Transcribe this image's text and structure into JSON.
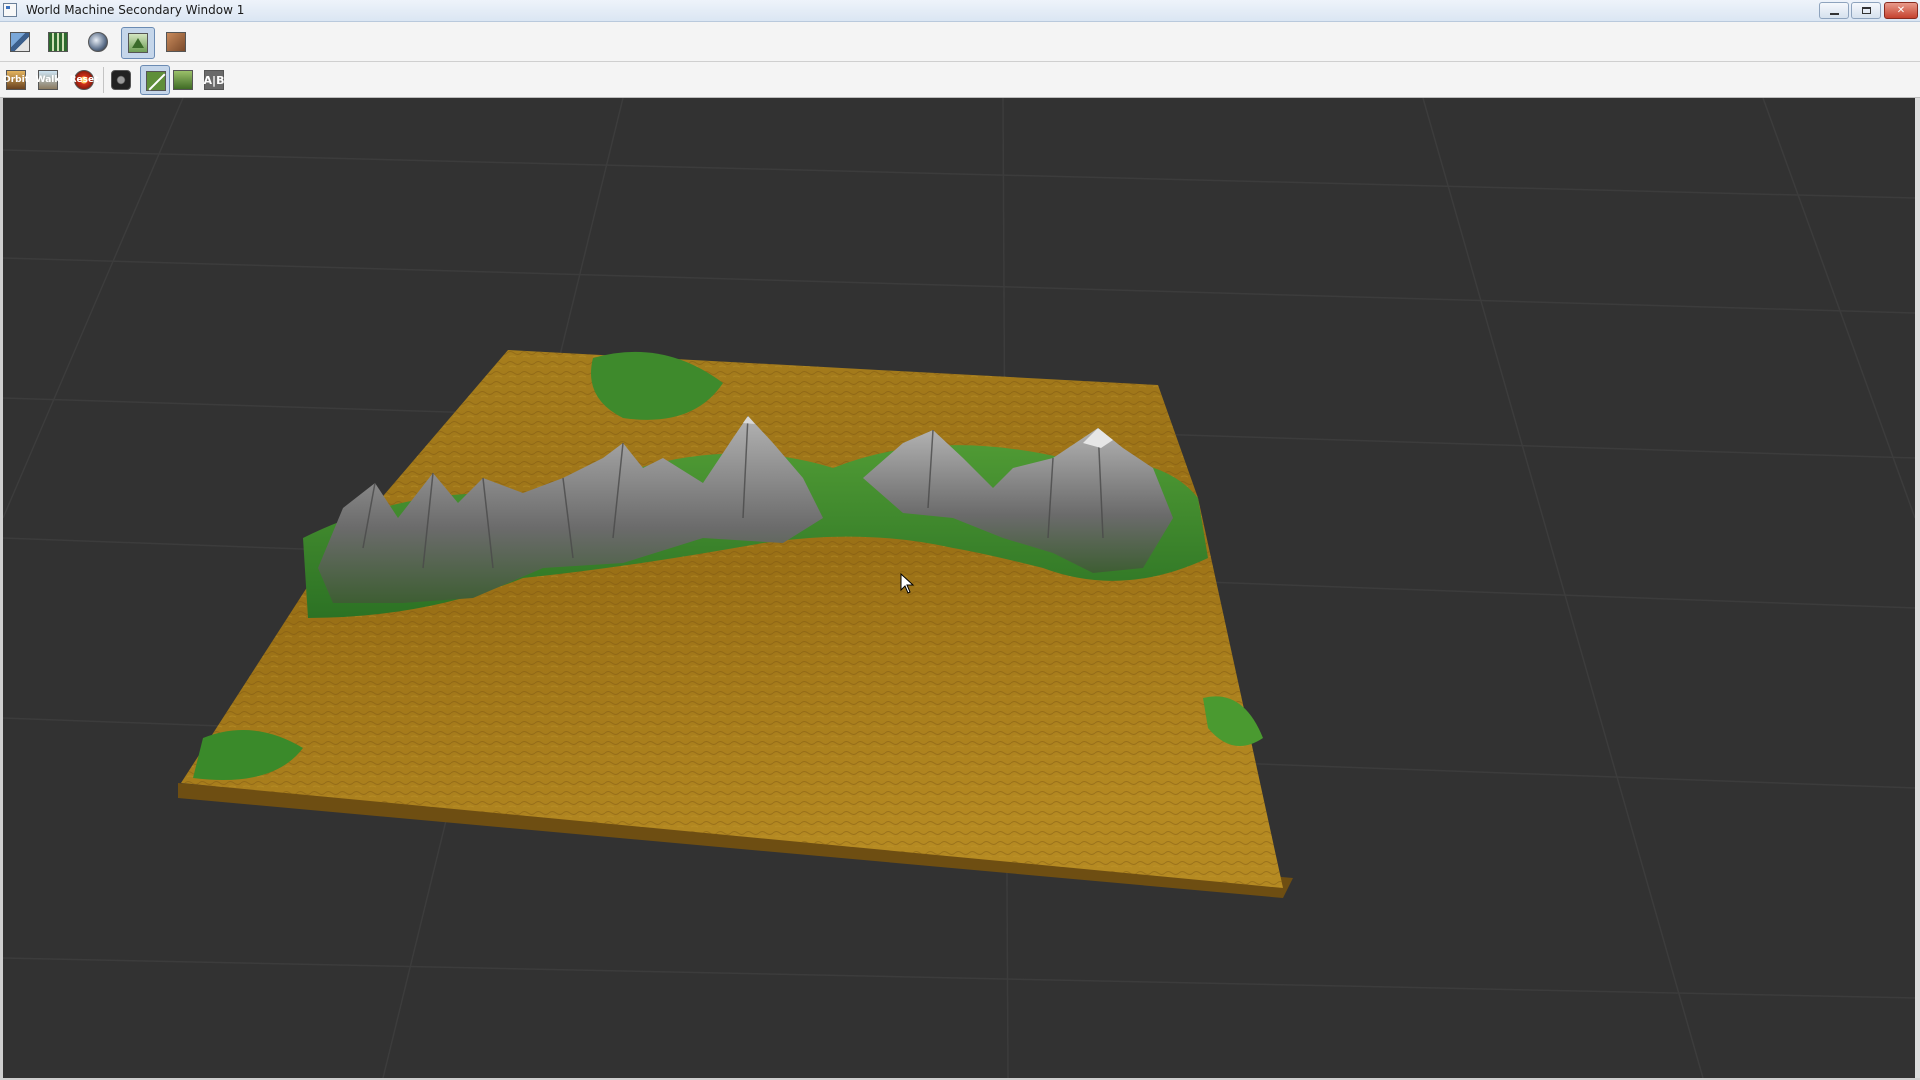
{
  "window": {
    "title": "World Machine Secondary Window 1",
    "controls": {
      "minimize": "",
      "maximize": "",
      "close": "✕"
    }
  },
  "toolbar1": {
    "buttons": [
      {
        "name": "device-view-icon"
      },
      {
        "name": "layout-view-icon"
      },
      {
        "name": "world-view-icon"
      },
      {
        "name": "3d-preview-icon",
        "active": true
      },
      {
        "name": "render-view-icon"
      }
    ]
  },
  "toolbar2": {
    "buttons": [
      {
        "name": "orbit-button",
        "label": "Orbit"
      },
      {
        "name": "walk-button",
        "label": "Walk"
      },
      {
        "name": "reset-button",
        "label": "Reset"
      },
      {
        "name": "camera-button"
      },
      {
        "name": "line-button",
        "active": true
      },
      {
        "name": "help-button"
      },
      {
        "name": "ab-button",
        "label": "A|B"
      }
    ]
  },
  "viewport": {
    "background": "#323232",
    "terrain_colors": {
      "low": "#a07618",
      "mid": "#3f8a2a",
      "high": "#7c7c7c",
      "snow": "#e6e6e6"
    }
  }
}
